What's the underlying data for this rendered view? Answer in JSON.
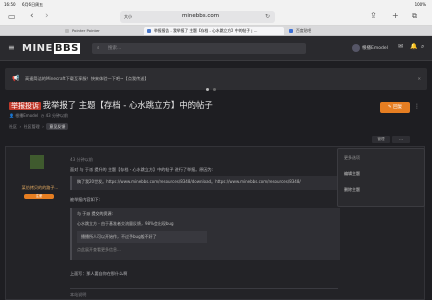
{
  "status": {
    "time": "16:50",
    "date": "6月6日周五",
    "battery": "100%"
  },
  "safari": {
    "page_icon": "大小",
    "url": "minebbs.com"
  },
  "tabs": [
    {
      "label": "Pointer Pointer"
    },
    {
      "label": "举报报告 - 我举报了 主题【存档 - 心水跳立方】中的帖子 | ..."
    },
    {
      "label": "百度贴吧"
    }
  ],
  "site": {
    "logo_a": "MINE",
    "logo_b": "BBS",
    "search_placeholder": "搜索...",
    "user": "根播Emodel"
  },
  "notice": {
    "text": "高速简洁的Minecraft下载互享服！快来体验一下吧~【点我传送】"
  },
  "thread": {
    "prefix": "举报投诉",
    "title": "我举报了 主题【存档 - 心水跳立方】中的帖子",
    "meta_user": "根播Emodel",
    "meta_time": "43 分钟以前",
    "action_button": "回复"
  },
  "breadcrumbs": [
    "社区",
    "社区管理",
    "意见反馈"
  ],
  "toolbar": {
    "time": "43 分钟以前",
    "manage": "管理",
    "more": "···"
  },
  "menu": {
    "title": "更多选项",
    "items": [
      "编辑主题",
      "删除主题"
    ]
  },
  "post": {
    "author": "某仿拷贝的的路子...",
    "badge": "注册",
    "time": "43 分钟以前",
    "line1": "面对 与 于派 提升的 主题【存档 - 心水跳立方】中的帖子 进行了举报。原因为:",
    "quote1": "稿了我20世发。https://www.minebbs.com/resources/8348/download。https://www.minebbs.com/resources/8348/",
    "line2": "被举报内容如下:",
    "quote2_title": "与 于派 提交的资源:",
    "quote2_line": "心水跳立方 - 由于基准者交流量反馈，98%会出现bug",
    "quote2_inner": "播播所人可以开始作，不过予bug般不好了",
    "quote2_more": "点此展开查看更多信息...",
    "footer": "上面写：那人要自你在那什么啊",
    "extra": "本站说明"
  },
  "colors": {
    "accent": "#e67e22",
    "label": "#c0392b",
    "bg": "#1e1e22"
  }
}
